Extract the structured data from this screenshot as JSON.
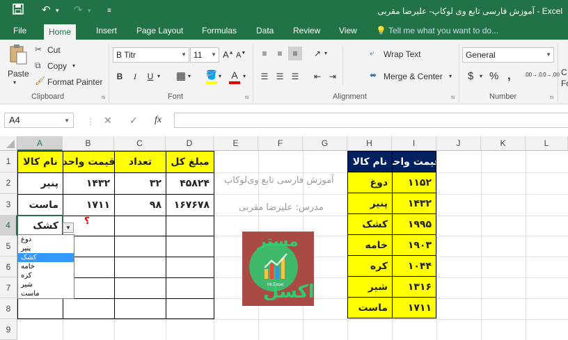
{
  "window": {
    "title": "آموزش فارسی تابع وی لوکاپ- علیرضا مقربی - Excel"
  },
  "quick_access": {
    "save_icon": "save-icon",
    "undo_icon": "undo-icon",
    "redo_icon": "redo-icon",
    "customize_icon": "customize-icon"
  },
  "tabs": [
    "File",
    "Home",
    "Insert",
    "Page Layout",
    "Formulas",
    "Data",
    "Review",
    "View"
  ],
  "tell_me": "Tell me what you want to do...",
  "clipboard": {
    "paste": "Paste",
    "cut": "Cut",
    "copy": "Copy",
    "format_painter": "Format Painter",
    "group": "Clipboard"
  },
  "font": {
    "name": "B Titr",
    "size": "11",
    "bold": "B",
    "italic": "I",
    "underline": "U",
    "group": "Font"
  },
  "alignment": {
    "wrap": "Wrap Text",
    "merge": "Merge & Center",
    "group": "Alignment"
  },
  "number": {
    "format": "General",
    "currency": "$",
    "percent": "%",
    "comma": ",",
    "inc_dec": ".00→.0",
    "dec_dec": ".0→.00",
    "group": "Number"
  },
  "cut_off": {
    "c": "C",
    "fo": "Fo"
  },
  "formula_bar": {
    "name_box": "A4",
    "cancel": "✕",
    "enter": "✓",
    "fx": "fx",
    "value": ""
  },
  "columns": [
    "A",
    "B",
    "C",
    "D",
    "E",
    "F",
    "G",
    "H",
    "I",
    "J",
    "K",
    "L"
  ],
  "rows": [
    "1",
    "2",
    "3",
    "4",
    "5",
    "6",
    "7",
    "8",
    "9"
  ],
  "table1": {
    "headers": [
      "نام کالا",
      "قیمت واحد",
      "تعداد",
      "مبلغ کل"
    ],
    "rows": [
      [
        "پنیر",
        "۱۴۳۲",
        "۳۲",
        "۴۵۸۲۴"
      ],
      [
        "ماست",
        "۱۷۱۱",
        "۹۸",
        "۱۶۷۶۷۸"
      ]
    ],
    "active_value": "کشک",
    "question": "؟"
  },
  "dropdown": {
    "options": [
      "دوغ",
      "پنیر",
      "کشک",
      "خامه",
      "کره",
      "شیر",
      "ماست"
    ],
    "selected_index": 2
  },
  "notes": {
    "line1": "آموزش فارسی تابع وی‌لوکاپ",
    "line2": "مدرس: علیرضا مقربی"
  },
  "logo": {
    "top": "مستر",
    "bottom": "اکسل",
    "sub": "Mr.Excel"
  },
  "table2": {
    "headers": [
      "نام کالا",
      "قیمت واحد"
    ],
    "rows": [
      [
        "دوغ",
        "۱۱۵۲"
      ],
      [
        "پنیر",
        "۱۴۳۲"
      ],
      [
        "کشک",
        "۱۹۹۵"
      ],
      [
        "خامه",
        "۱۹۰۳"
      ],
      [
        "کره",
        "۱۰۴۴"
      ],
      [
        "شیر",
        "۱۳۱۶"
      ],
      [
        "ماست",
        "۱۷۱۱"
      ]
    ]
  }
}
